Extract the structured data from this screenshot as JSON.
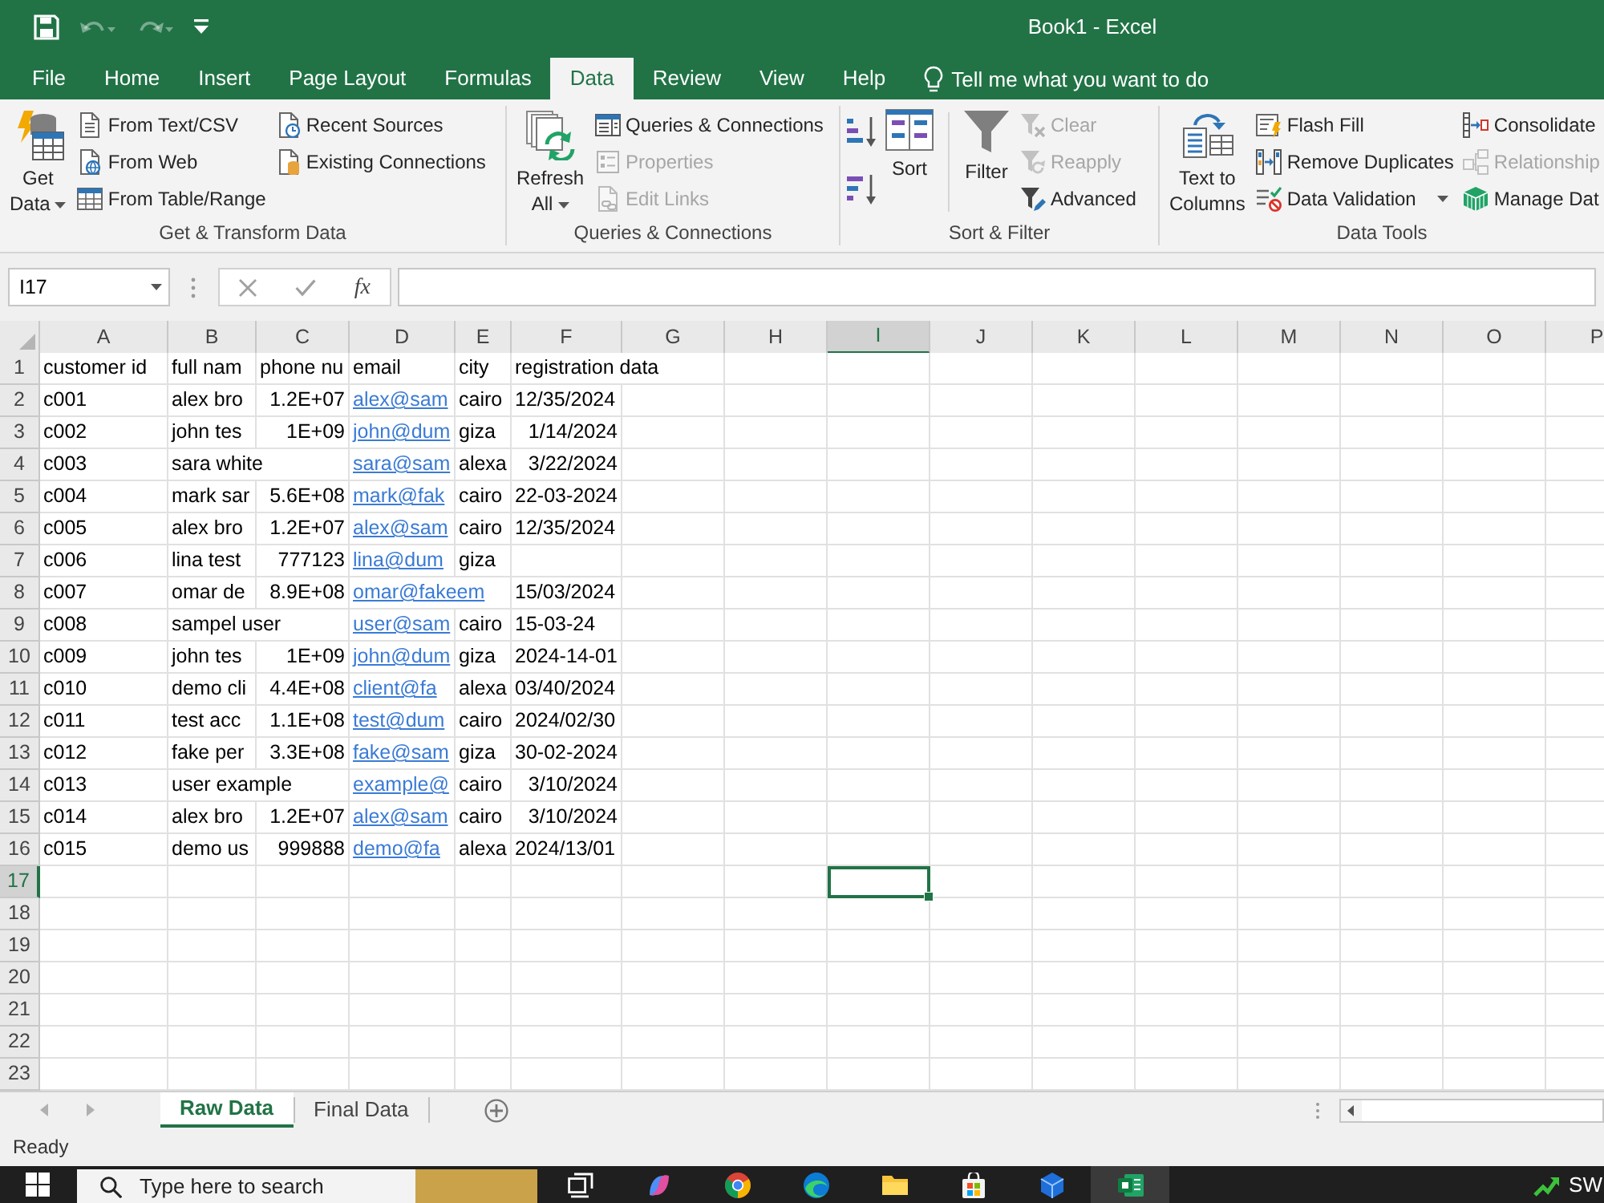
{
  "window": {
    "title": "Book1 - Excel"
  },
  "quick_access": [
    {
      "kind": "save",
      "disabled": false
    },
    {
      "kind": "undo",
      "disabled": true
    },
    {
      "kind": "redo",
      "disabled": true
    },
    {
      "kind": "customize",
      "disabled": false
    }
  ],
  "tabs": [
    {
      "label": "File",
      "selected": false
    },
    {
      "label": "Home",
      "selected": false
    },
    {
      "label": "Insert",
      "selected": false
    },
    {
      "label": "Page Layout",
      "selected": false
    },
    {
      "label": "Formulas",
      "selected": false
    },
    {
      "label": "Data",
      "selected": true
    },
    {
      "label": "Review",
      "selected": false
    },
    {
      "label": "View",
      "selected": false
    },
    {
      "label": "Help",
      "selected": false
    }
  ],
  "tell_me": {
    "placeholder": "Tell me what you want to do"
  },
  "ribbon": {
    "groups": [
      {
        "label": "Get & Transform Data",
        "buttons": [
          {
            "kind": "large",
            "label": "Get Data",
            "dropdown": true,
            "disabled": false
          },
          {
            "kind": "small",
            "label": "From Text/CSV",
            "dropdown": false,
            "disabled": false
          },
          {
            "kind": "small",
            "label": "From Web",
            "dropdown": false,
            "disabled": false
          },
          {
            "kind": "small",
            "label": "From Table/Range",
            "dropdown": false,
            "disabled": false
          },
          {
            "kind": "small",
            "label": "Recent Sources",
            "dropdown": false,
            "disabled": false
          },
          {
            "kind": "small",
            "label": "Existing Connections",
            "dropdown": false,
            "disabled": false
          }
        ]
      },
      {
        "label": "Queries & Connections",
        "buttons": [
          {
            "kind": "large",
            "label": "Refresh All",
            "dropdown": true,
            "disabled": false
          },
          {
            "kind": "small",
            "label": "Queries & Connections",
            "dropdown": false,
            "disabled": false
          },
          {
            "kind": "small",
            "label": "Properties",
            "dropdown": false,
            "disabled": true
          },
          {
            "kind": "small",
            "label": "Edit Links",
            "dropdown": false,
            "disabled": true
          }
        ]
      },
      {
        "label": "Sort & Filter",
        "buttons": [
          {
            "kind": "icon",
            "disabled": false
          },
          {
            "kind": "icon",
            "disabled": false
          },
          {
            "kind": "large",
            "label": "Sort",
            "dropdown": false,
            "disabled": false
          },
          {
            "kind": "separator"
          },
          {
            "kind": "large",
            "label": "Filter",
            "dropdown": false,
            "disabled": false
          },
          {
            "kind": "small",
            "label": "Clear",
            "dropdown": false,
            "disabled": true
          },
          {
            "kind": "small",
            "label": "Reapply",
            "dropdown": false,
            "disabled": true
          },
          {
            "kind": "small",
            "label": "Advanced",
            "dropdown": false,
            "disabled": false
          }
        ]
      },
      {
        "label": "Data Tools",
        "buttons": [
          {
            "kind": "large",
            "label": "Text to Columns",
            "dropdown": false,
            "disabled": false
          },
          {
            "kind": "small",
            "label": "Flash Fill",
            "dropdown": false,
            "disabled": false
          },
          {
            "kind": "small",
            "label": "Remove Duplicates",
            "dropdown": false,
            "disabled": false
          },
          {
            "kind": "small",
            "label": "Data Validation",
            "dropdown": true,
            "disabled": false
          },
          {
            "kind": "small",
            "label": "Consolidate",
            "dropdown": false,
            "disabled": false
          },
          {
            "kind": "small",
            "label": "Relationship",
            "dropdown": false,
            "disabled": true
          },
          {
            "kind": "small",
            "label": "Manage Dat",
            "dropdown": false,
            "disabled": false
          }
        ]
      }
    ]
  },
  "formula_bar": {
    "name_box": "I17",
    "insert_function": "fx"
  },
  "grid": {
    "columns": [
      {
        "label": "A",
        "selected": false
      },
      {
        "label": "B",
        "selected": false
      },
      {
        "label": "C",
        "selected": false
      },
      {
        "label": "D",
        "selected": false
      },
      {
        "label": "E",
        "selected": false
      },
      {
        "label": "F",
        "selected": false
      },
      {
        "label": "G",
        "selected": false
      },
      {
        "label": "H",
        "selected": false
      },
      {
        "label": "I",
        "selected": true
      },
      {
        "label": "J",
        "selected": false
      },
      {
        "label": "K",
        "selected": false
      },
      {
        "label": "L",
        "selected": false
      },
      {
        "label": "M",
        "selected": false
      },
      {
        "label": "N",
        "selected": false
      },
      {
        "label": "O",
        "selected": false
      },
      {
        "label": "P",
        "selected": false
      }
    ],
    "rows": [
      {
        "label": "1",
        "selected": false,
        "cells": [
          {
            "text": "customer id",
            "kind": "text"
          },
          {
            "text": "full nam",
            "kind": "text"
          },
          {
            "text": "phone nu",
            "kind": "text"
          },
          {
            "text": "email",
            "kind": "text"
          },
          {
            "text": "city",
            "kind": "text"
          },
          {
            "text": "registration data",
            "kind": "text"
          }
        ]
      },
      {
        "label": "2",
        "selected": false,
        "cells": [
          {
            "text": "c001",
            "kind": "text"
          },
          {
            "text": "alex bro",
            "kind": "text"
          },
          {
            "text": "1.2E+07",
            "kind": "number"
          },
          {
            "text": "alex@sam",
            "kind": "link"
          },
          {
            "text": "cairo",
            "kind": "text"
          },
          {
            "text": "12/35/2024",
            "kind": "text"
          }
        ]
      },
      {
        "label": "3",
        "selected": false,
        "cells": [
          {
            "text": "c002",
            "kind": "text"
          },
          {
            "text": "john tes",
            "kind": "text"
          },
          {
            "text": "1E+09",
            "kind": "number"
          },
          {
            "text": "john@dum",
            "kind": "link"
          },
          {
            "text": "giza",
            "kind": "text"
          },
          {
            "text": "1/14/2024",
            "kind": "number"
          }
        ]
      },
      {
        "label": "4",
        "selected": false,
        "cells": [
          {
            "text": "c003",
            "kind": "text"
          },
          {
            "text": "sara white",
            "kind": "text"
          },
          null,
          {
            "text": "sara@sam",
            "kind": "link"
          },
          {
            "text": "alexa",
            "kind": "text"
          },
          {
            "text": "3/22/2024",
            "kind": "number"
          }
        ]
      },
      {
        "label": "5",
        "selected": false,
        "cells": [
          {
            "text": "c004",
            "kind": "text"
          },
          {
            "text": "mark sar",
            "kind": "text"
          },
          {
            "text": "5.6E+08",
            "kind": "number"
          },
          {
            "text": "mark@fak",
            "kind": "link"
          },
          {
            "text": "cairo",
            "kind": "text"
          },
          {
            "text": "22-03-2024",
            "kind": "text"
          }
        ]
      },
      {
        "label": "6",
        "selected": false,
        "cells": [
          {
            "text": "c005",
            "kind": "text"
          },
          {
            "text": "alex bro",
            "kind": "text"
          },
          {
            "text": "1.2E+07",
            "kind": "number"
          },
          {
            "text": "alex@sam",
            "kind": "link"
          },
          {
            "text": "cairo",
            "kind": "text"
          },
          {
            "text": "12/35/2024",
            "kind": "text"
          }
        ]
      },
      {
        "label": "7",
        "selected": false,
        "cells": [
          {
            "text": "c006",
            "kind": "text"
          },
          {
            "text": "lina test",
            "kind": "text"
          },
          {
            "text": "777123",
            "kind": "number"
          },
          {
            "text": "lina@dum",
            "kind": "link"
          },
          {
            "text": "giza",
            "kind": "text"
          },
          null
        ]
      },
      {
        "label": "8",
        "selected": false,
        "cells": [
          {
            "text": "c007",
            "kind": "text"
          },
          {
            "text": "omar de",
            "kind": "text"
          },
          {
            "text": "8.9E+08",
            "kind": "number"
          },
          {
            "text": "omar@fakeem",
            "kind": "link"
          },
          null,
          {
            "text": "15/03/2024",
            "kind": "text"
          }
        ]
      },
      {
        "label": "9",
        "selected": false,
        "cells": [
          {
            "text": "c008",
            "kind": "text"
          },
          {
            "text": "sampel user",
            "kind": "text"
          },
          null,
          {
            "text": "user@sam",
            "kind": "link"
          },
          {
            "text": "cairo",
            "kind": "text"
          },
          {
            "text": "15-03-24",
            "kind": "text"
          }
        ]
      },
      {
        "label": "10",
        "selected": false,
        "cells": [
          {
            "text": "c009",
            "kind": "text"
          },
          {
            "text": "john tes",
            "kind": "text"
          },
          {
            "text": "1E+09",
            "kind": "number"
          },
          {
            "text": "john@dum",
            "kind": "link"
          },
          {
            "text": "giza",
            "kind": "text"
          },
          {
            "text": "2024-14-01",
            "kind": "text"
          }
        ]
      },
      {
        "label": "11",
        "selected": false,
        "cells": [
          {
            "text": "c010",
            "kind": "text"
          },
          {
            "text": "demo cli",
            "kind": "text"
          },
          {
            "text": "4.4E+08",
            "kind": "number"
          },
          {
            "text": "client@fa",
            "kind": "link"
          },
          {
            "text": "alexa",
            "kind": "text"
          },
          {
            "text": "03/40/2024",
            "kind": "text"
          }
        ]
      },
      {
        "label": "12",
        "selected": false,
        "cells": [
          {
            "text": "c011",
            "kind": "text"
          },
          {
            "text": "test acc",
            "kind": "text"
          },
          {
            "text": "1.1E+08",
            "kind": "number"
          },
          {
            "text": "test@dum",
            "kind": "link"
          },
          {
            "text": "cairo",
            "kind": "text"
          },
          {
            "text": "2024/02/30",
            "kind": "text"
          }
        ]
      },
      {
        "label": "13",
        "selected": false,
        "cells": [
          {
            "text": "c012",
            "kind": "text"
          },
          {
            "text": "fake per",
            "kind": "text"
          },
          {
            "text": "3.3E+08",
            "kind": "number"
          },
          {
            "text": "fake@sam",
            "kind": "link"
          },
          {
            "text": "giza",
            "kind": "text"
          },
          {
            "text": "30-02-2024",
            "kind": "text"
          }
        ]
      },
      {
        "label": "14",
        "selected": false,
        "cells": [
          {
            "text": "c013",
            "kind": "text"
          },
          {
            "text": "user example",
            "kind": "text"
          },
          null,
          {
            "text": "example@",
            "kind": "link"
          },
          {
            "text": "cairo",
            "kind": "text"
          },
          {
            "text": "3/10/2024",
            "kind": "number"
          }
        ]
      },
      {
        "label": "15",
        "selected": false,
        "cells": [
          {
            "text": "c014",
            "kind": "text"
          },
          {
            "text": "alex bro",
            "kind": "text"
          },
          {
            "text": "1.2E+07",
            "kind": "number"
          },
          {
            "text": "alex@sam",
            "kind": "link"
          },
          {
            "text": "cairo",
            "kind": "text"
          },
          {
            "text": "3/10/2024",
            "kind": "number"
          }
        ]
      },
      {
        "label": "16",
        "selected": false,
        "cells": [
          {
            "text": "c015",
            "kind": "text"
          },
          {
            "text": "demo us",
            "kind": "text"
          },
          {
            "text": "999888",
            "kind": "number"
          },
          {
            "text": "demo@fa",
            "kind": "link"
          },
          {
            "text": "alexa",
            "kind": "text"
          },
          {
            "text": "2024/13/01",
            "kind": "text"
          }
        ]
      },
      {
        "label": "17",
        "selected": true
      },
      {
        "label": "18",
        "selected": false
      },
      {
        "label": "19",
        "selected": false
      },
      {
        "label": "20",
        "selected": false
      },
      {
        "label": "21",
        "selected": false
      },
      {
        "label": "22",
        "selected": false
      },
      {
        "label": "23",
        "selected": false
      }
    ]
  },
  "sheets": [
    {
      "label": "Raw Data",
      "selected": true
    },
    {
      "label": "Final Data",
      "selected": false
    }
  ],
  "status_bar": {
    "text": "Ready"
  },
  "taskbar": {
    "search": {
      "placeholder": "Type here to search"
    },
    "apps": [
      {
        "kind": "task_view",
        "active": false
      },
      {
        "kind": "swirl",
        "active": false
      },
      {
        "kind": "ring",
        "active": false
      },
      {
        "kind": "wave",
        "active": false
      },
      {
        "kind": "folder",
        "active": false
      },
      {
        "kind": "bag",
        "active": false
      },
      {
        "kind": "cube",
        "active": false
      },
      {
        "kind": "sheet",
        "active": true
      }
    ],
    "tray_text": "SW"
  }
}
